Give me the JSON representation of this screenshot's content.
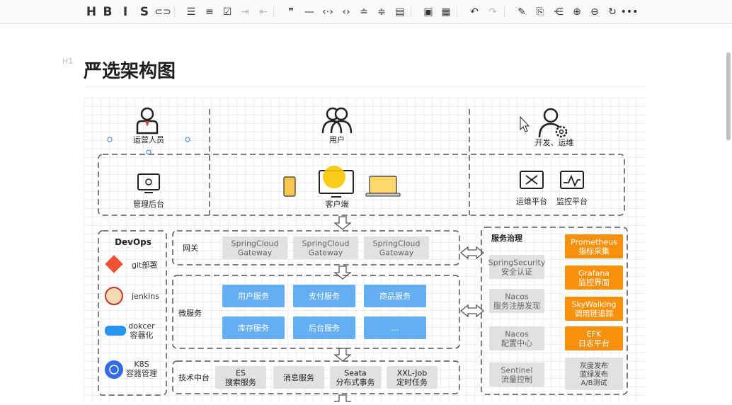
{
  "toolbar": {
    "items": [
      {
        "icon": "heading-icon",
        "glyph": "H"
      },
      {
        "icon": "bold-icon",
        "glyph": "B"
      },
      {
        "icon": "italic-icon",
        "glyph": "I"
      },
      {
        "icon": "strikethrough-icon",
        "glyph": "S"
      },
      {
        "icon": "link-icon",
        "glyph": "⊂⊃"
      },
      {
        "icon": "unordered-list-icon",
        "glyph": "☰"
      },
      {
        "icon": "ordered-list-icon",
        "glyph": "≡"
      },
      {
        "icon": "task-list-icon",
        "glyph": "☑"
      },
      {
        "icon": "indent-icon",
        "glyph": "⇥"
      },
      {
        "icon": "outdent-icon",
        "glyph": "⇤"
      },
      {
        "icon": "quote-icon",
        "glyph": "❞"
      },
      {
        "icon": "horizontal-rule-icon",
        "glyph": "—"
      },
      {
        "icon": "inline-code-icon",
        "glyph": "‹·›"
      },
      {
        "icon": "code-block-icon",
        "glyph": "‹›"
      },
      {
        "icon": "insert-before-icon",
        "glyph": "≐"
      },
      {
        "icon": "insert-after-icon",
        "glyph": "≑"
      },
      {
        "icon": "table-of-contents-icon",
        "glyph": "▤"
      },
      {
        "icon": "image-icon",
        "glyph": "▣"
      },
      {
        "icon": "table-icon",
        "glyph": "▦"
      },
      {
        "icon": "undo-icon",
        "glyph": "↶"
      },
      {
        "icon": "redo-icon",
        "glyph": "↷"
      },
      {
        "icon": "edit-icon",
        "glyph": "✎"
      },
      {
        "icon": "preview-icon",
        "glyph": "⎘"
      },
      {
        "icon": "mind-map-icon",
        "glyph": "⋲"
      },
      {
        "icon": "zoom-in-icon",
        "glyph": "⊕"
      },
      {
        "icon": "zoom-out-icon",
        "glyph": "⊖"
      },
      {
        "icon": "refresh-icon",
        "glyph": "↻"
      },
      {
        "icon": "more-icon",
        "glyph": "•••"
      }
    ]
  },
  "editor": {
    "heading_tag": "H1",
    "title": "严选架构图"
  },
  "diagram": {
    "roles": {
      "ops": "运营人员",
      "user": "用户",
      "dev": "开发、运维"
    },
    "access": {
      "admin": "管理后台",
      "client": "客户端",
      "ops_platform": "运维平台",
      "monitor_platform": "监控平台"
    },
    "devops": {
      "title": "DevOps",
      "items": [
        {
          "label": "git部署",
          "icon": "git-icon"
        },
        {
          "label": "jenkins",
          "icon": "jenkins-icon"
        },
        {
          "label": "dokcer\n容器化",
          "icon": "docker-icon"
        },
        {
          "label": "K8S\n容器管理",
          "icon": "kubernetes-icon"
        }
      ]
    },
    "gateway": {
      "label": "网关",
      "items": [
        "SpringCloud\nGateway",
        "SpringCloud\nGateway",
        "SpringCloud\nGateway"
      ]
    },
    "micro": {
      "label": "微服务",
      "items": [
        "用户服务",
        "支付服务",
        "商品服务",
        "库存服务",
        "后台服务",
        "..."
      ]
    },
    "tech": {
      "label": "技术中台",
      "items": [
        "ES\n搜索服务",
        "消息服务",
        "Seata\n分布式事务",
        "XXL-Job\n定时任务"
      ]
    },
    "governance": {
      "title": "服务治理",
      "left": [
        "SpringSecurity\n安全认证",
        "Nacos\n服务注册发现",
        "Nacos\n配置中心",
        "Sentinel\n流量控制"
      ],
      "right": [
        "Prometheus\n指标采集",
        "Grafana\n监控界面",
        "SkyWalking\n调用链追踪",
        "EFK\n日志平台",
        "灰度发布\n蓝绿发布\nA/B测试"
      ]
    },
    "colors": {
      "blue": "#64aef3",
      "orange": "#f7910d",
      "gray": "#e1e1e1",
      "dash": "#555555"
    }
  }
}
